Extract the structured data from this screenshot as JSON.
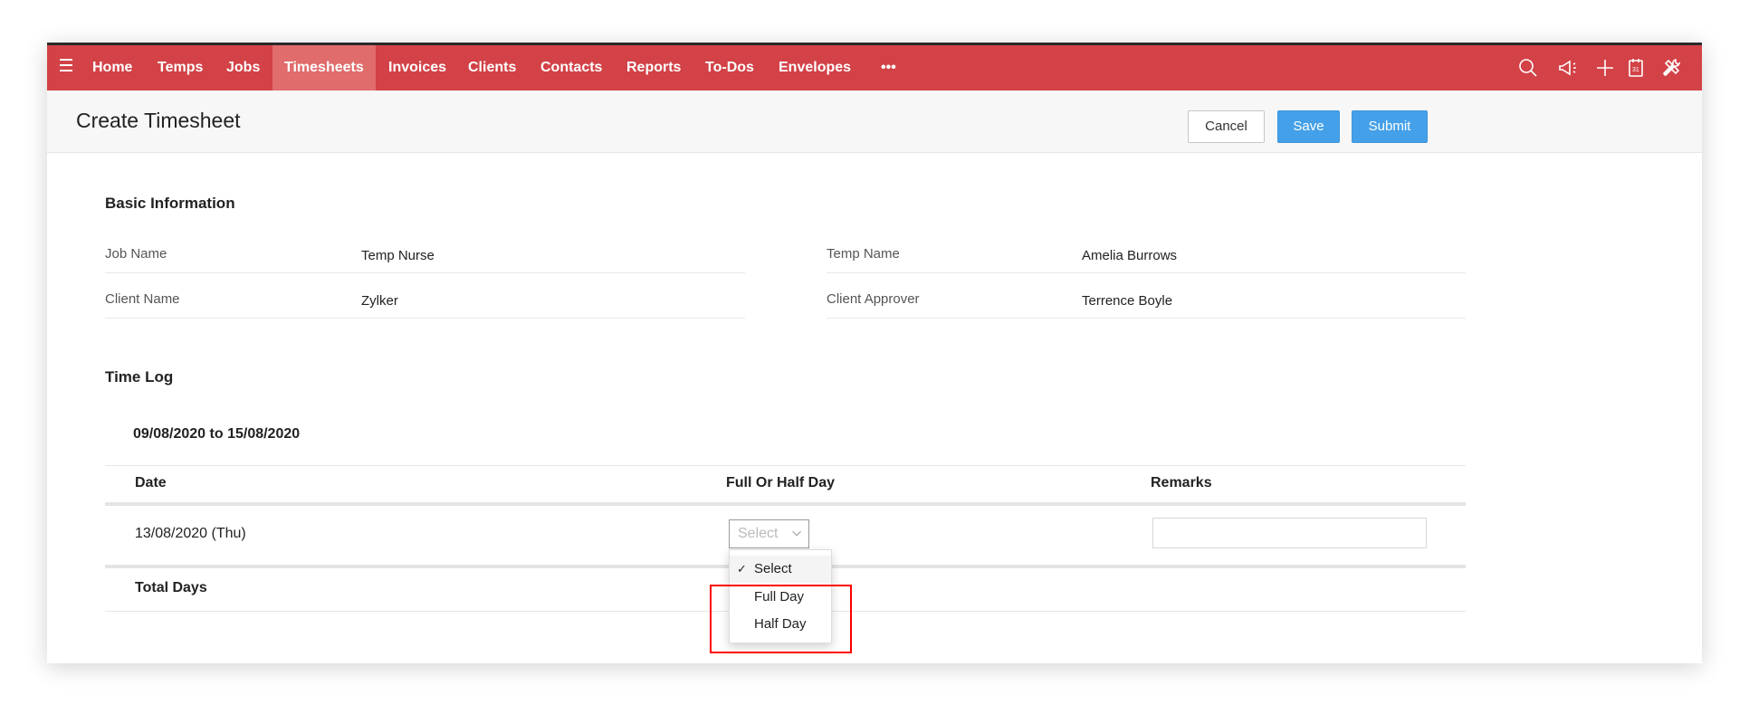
{
  "nav": {
    "items": [
      "Home",
      "Temps",
      "Jobs",
      "Timesheets",
      "Invoices",
      "Clients",
      "Contacts",
      "Reports",
      "To-Dos",
      "Envelopes"
    ],
    "more": "•••",
    "active": "Timesheets"
  },
  "header": {
    "title": "Create Timesheet",
    "cancel": "Cancel",
    "save": "Save",
    "submit": "Submit"
  },
  "basic": {
    "heading": "Basic Information",
    "job_name_label": "Job Name",
    "job_name": "Temp Nurse",
    "temp_name_label": "Temp Name",
    "temp_name": "Amelia Burrows",
    "client_name_label": "Client Name",
    "client_name": "Zylker",
    "client_approver_label": "Client Approver",
    "client_approver": "Terrence Boyle"
  },
  "timelog": {
    "heading": "Time Log",
    "range": "09/08/2020 to 15/08/2020",
    "columns": [
      "Date",
      "Full Or Half Day",
      "Remarks"
    ],
    "rows": [
      {
        "date": "13/08/2020 (Thu)",
        "selected": "Select",
        "remarks": ""
      }
    ],
    "total_label": "Total Days"
  },
  "dropdown": {
    "options": [
      "Select",
      "Full Day",
      "Half Day"
    ],
    "checked": "Select"
  },
  "colors": {
    "nav": "#d24247",
    "active_tab": "#e06c6c",
    "primary": "#44a0e8",
    "highlight": "#ff0000"
  }
}
